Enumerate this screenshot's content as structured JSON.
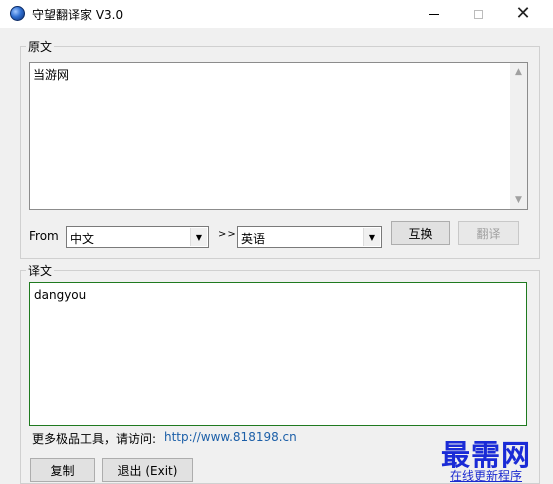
{
  "window": {
    "title": "守望翻译家 V3.0",
    "minimize_glyph": "",
    "close_glyph": "✕"
  },
  "source": {
    "group_label": "原文",
    "text": "当游网",
    "scroll_up_glyph": "▲",
    "scroll_down_glyph": "▼"
  },
  "languages": {
    "from_label": "From",
    "from_value": "中文",
    "separator": ">>",
    "to_value": "英语",
    "dropdown_glyph": "▼"
  },
  "buttons": {
    "swap": "互换",
    "translate": "翻译",
    "copy": "复制",
    "exit": "退出 (Exit)"
  },
  "result": {
    "group_label": "译文",
    "text": "dangyou"
  },
  "footer": {
    "promo_text": "更多极品工具，请访问:",
    "promo_url": "http://www.818198.cn",
    "watermark": "最需网",
    "update_link": "在线更新程序"
  }
}
